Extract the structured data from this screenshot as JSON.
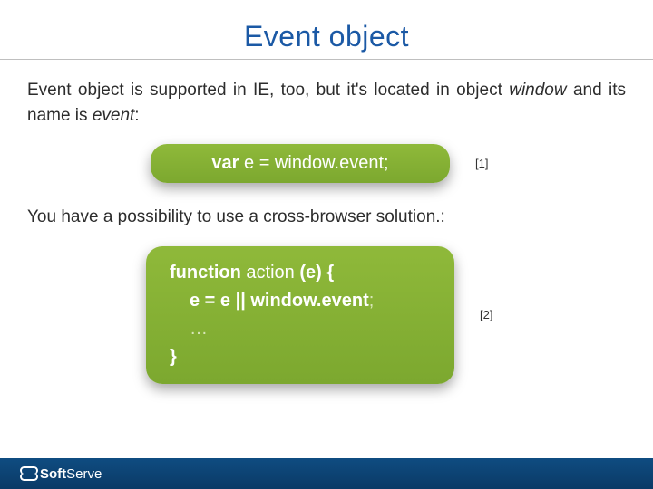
{
  "title": "Event object",
  "para1_html": "Event object is supported in IE, too, but it's located in object <em>window</em> and its name is <em>event</em>:",
  "para2": "You have a possibility to use a cross-browser solution.:",
  "code1": {
    "kw": "var",
    "rest": " e = window.event;"
  },
  "code2": {
    "line1_kw": "function",
    "line1_fn": " action ",
    "line1_rest": "(e) {",
    "line2": "e = e || window.event",
    "line2_semi": ";",
    "line3": "…",
    "line4": "}"
  },
  "refs": {
    "r1": "[1]",
    "r2": "[2]"
  },
  "footer": {
    "brand_bold": "Soft",
    "brand_light": "Serve"
  }
}
